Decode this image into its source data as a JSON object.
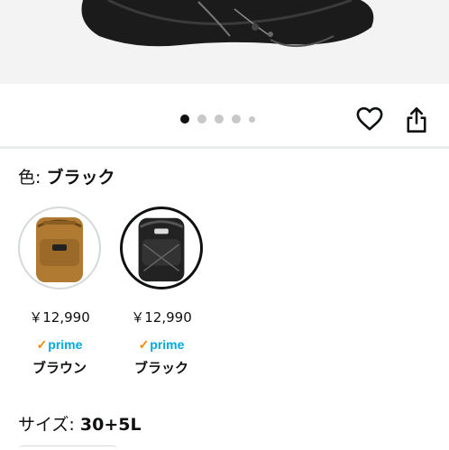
{
  "product_image": {
    "icon": "backpack-product-photo"
  },
  "carousel": {
    "total": 5,
    "active_index": 0
  },
  "actions": {
    "favorite_icon": "heart-icon",
    "share_icon": "share-icon"
  },
  "color": {
    "label": "色: ",
    "selected_value": "ブラック"
  },
  "swatches": [
    {
      "price": "￥12,990",
      "prime_check": "✓",
      "prime_text": "prime",
      "name": "ブラウン",
      "selected": false,
      "color": "#b07a32"
    },
    {
      "price": "￥12,990",
      "prime_check": "✓",
      "prime_text": "prime",
      "name": "ブラック",
      "selected": true,
      "color": "#222222"
    }
  ],
  "size": {
    "label": "サイズ: ",
    "selected_value": "30+5L"
  }
}
